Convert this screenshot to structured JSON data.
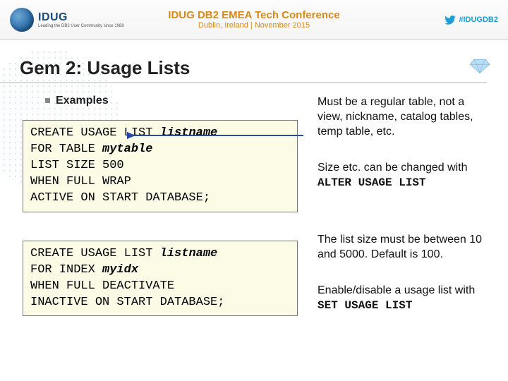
{
  "header": {
    "org_name": "IDUG",
    "org_tagline": "Leading the DB2 User Community since 1988",
    "conference_title": "IDUG DB2 EMEA Tech Conference",
    "conference_sub": "Dublin, Ireland  |  November 2015",
    "hashtag": "#IDUGDB2"
  },
  "title": "Gem 2: Usage Lists",
  "bullet": "Examples",
  "code1": {
    "l1a": "CREATE USAGE LIST ",
    "l1b": "listname",
    "l2a": "FOR TABLE ",
    "l2b": "mytable",
    "l3": "LIST SIZE 500",
    "l4": "WHEN FULL WRAP",
    "l5": "ACTIVE ON START DATABASE;"
  },
  "code2": {
    "l1a": "CREATE USAGE LIST ",
    "l1b": "listname",
    "l2a": "FOR INDEX ",
    "l2b": "myidx",
    "l3": "WHEN FULL DEACTIVATE",
    "l4": "INACTIVE ON START DATABASE;"
  },
  "notes": {
    "n1": "Must be a regular table, not a view, nickname, catalog tables, temp table, etc.",
    "n2a": "Size etc. can be changed with ",
    "n2b": "ALTER USAGE LIST",
    "n3": "The list size must be between 10 and 5000. Default is 100.",
    "n4a": "Enable/disable a usage list with ",
    "n4b": "SET USAGE LIST"
  }
}
